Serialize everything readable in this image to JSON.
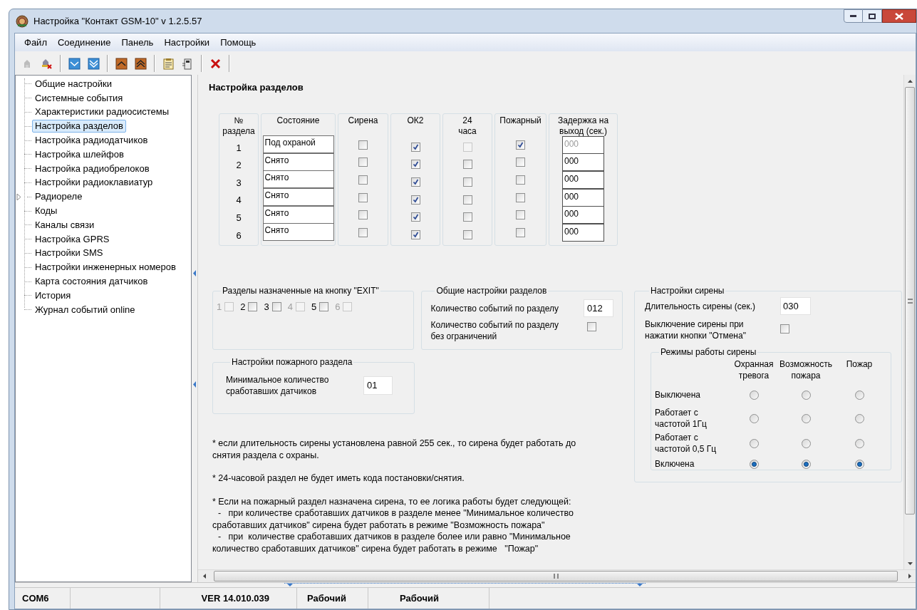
{
  "window": {
    "title": "Настройка \"Контакт GSM-10\" v 1.2.5.57"
  },
  "menu": [
    "Файл",
    "Соединение",
    "Панель",
    "Настройки",
    "Помощь"
  ],
  "toolbar": [
    {
      "kind": "connect",
      "disabled": true
    },
    {
      "kind": "disconnect",
      "disabled": false
    },
    {
      "kind": "separator"
    },
    {
      "kind": "read",
      "disabled": false
    },
    {
      "kind": "read-all",
      "disabled": false
    },
    {
      "kind": "separator"
    },
    {
      "kind": "write",
      "disabled": false
    },
    {
      "kind": "write-all",
      "disabled": false
    },
    {
      "kind": "separator"
    },
    {
      "kind": "notes",
      "disabled": false
    },
    {
      "kind": "device",
      "disabled": false
    },
    {
      "kind": "separator"
    },
    {
      "kind": "delete",
      "disabled": false
    },
    {
      "kind": "separator"
    }
  ],
  "tree": {
    "items": [
      {
        "label": "Общие настройки",
        "kind": "leaf",
        "selected": false
      },
      {
        "label": "Системные события",
        "kind": "leaf",
        "selected": false
      },
      {
        "label": "Характеристики радиосистемы",
        "kind": "leaf",
        "selected": false
      },
      {
        "label": "Настройка разделов",
        "kind": "leaf",
        "selected": true
      },
      {
        "label": "Настройка радиодатчиков",
        "kind": "leaf",
        "selected": false
      },
      {
        "label": "Настройка шлейфов",
        "kind": "leaf",
        "selected": false
      },
      {
        "label": "Настройка радиобрелоков",
        "kind": "leaf",
        "selected": false
      },
      {
        "label": "Настройки радиоклавиатур",
        "kind": "leaf",
        "selected": false
      },
      {
        "label": "Радиореле",
        "kind": "folder",
        "expanded": false,
        "selected": false
      },
      {
        "label": "Коды",
        "kind": "leaf",
        "selected": false
      },
      {
        "label": "Каналы связи",
        "kind": "leaf",
        "selected": false
      },
      {
        "label": "Настройка GPRS",
        "kind": "leaf",
        "selected": false
      },
      {
        "label": "Настройки SMS",
        "kind": "leaf",
        "selected": false
      },
      {
        "label": "Настройки инженерных номеров",
        "kind": "leaf",
        "selected": false
      },
      {
        "label": "Карта состояния датчиков",
        "kind": "leaf",
        "selected": false
      },
      {
        "label": "История",
        "kind": "leaf",
        "selected": false
      },
      {
        "label": "Журнал событий online",
        "kind": "leaf",
        "selected": false
      }
    ]
  },
  "partitions": {
    "title": "Настройка разделов",
    "columns": [
      "№\nраздела",
      "Состояние",
      "Сирена",
      "ОК2",
      "24\nчаса",
      "Пожарный",
      "Задержка на\nвыход (сек.)"
    ],
    "rows": [
      {
        "number": "1",
        "state": "Под охраной",
        "siren": false,
        "ok2": true,
        "h24_checked": false,
        "h24_disabled": true,
        "fire": true,
        "delay": "000",
        "delay_disabled": true
      },
      {
        "number": "2",
        "state": "Снято",
        "siren": false,
        "ok2": true,
        "h24_checked": false,
        "h24_disabled": false,
        "fire": false,
        "delay": "000",
        "delay_disabled": false
      },
      {
        "number": "3",
        "state": "Снято",
        "siren": false,
        "ok2": true,
        "h24_checked": false,
        "h24_disabled": false,
        "fire": false,
        "delay": "000",
        "delay_disabled": false
      },
      {
        "number": "4",
        "state": "Снято",
        "siren": false,
        "ok2": true,
        "h24_checked": false,
        "h24_disabled": false,
        "fire": false,
        "delay": "000",
        "delay_disabled": false
      },
      {
        "number": "5",
        "state": "Снято",
        "siren": false,
        "ok2": true,
        "h24_checked": false,
        "h24_disabled": false,
        "fire": false,
        "delay": "000",
        "delay_disabled": false
      },
      {
        "number": "6",
        "state": "Снято",
        "siren": false,
        "ok2": true,
        "h24_checked": false,
        "h24_disabled": false,
        "fire": false,
        "delay": "000",
        "delay_disabled": false
      }
    ]
  },
  "exit_group": {
    "title": "Разделы назначенные на кнопку \"EXIT\"",
    "items": [
      {
        "label": "1",
        "checked": false,
        "disabled": true
      },
      {
        "label": "2",
        "checked": false,
        "disabled": false
      },
      {
        "label": "3",
        "checked": false,
        "disabled": false
      },
      {
        "label": "4",
        "checked": false,
        "disabled": true
      },
      {
        "label": "5",
        "checked": false,
        "disabled": false
      },
      {
        "label": "6",
        "checked": false,
        "disabled": true
      }
    ]
  },
  "general_group": {
    "title": "Общие настройки разделов",
    "events_label": "Количество событий по разделу",
    "events_value": "012",
    "unlimited_label": "Количество событий по разделу\nбез ограничений",
    "unlimited_checked": false
  },
  "fire_group": {
    "title": "Настройки пожарного раздела",
    "label": "Минимальное количество\nсработавших датчиков",
    "value": "01"
  },
  "siren_group": {
    "title": "Настройки сирены",
    "duration_label": "Длительность сирены (сек.)",
    "duration_value": "030",
    "cancel_label": "Выключение сирены при\nнажатии кнопки \"Отмена\"",
    "cancel_checked": false,
    "modes": {
      "title": "Режимы работы сирены",
      "columns": [
        "Охранная\nтревога",
        "Возможность\nпожара",
        "Пожар"
      ],
      "rows": [
        {
          "label": "Выключена",
          "options": [
            {
              "selected": false
            },
            {
              "selected": false
            },
            {
              "selected": false
            }
          ]
        },
        {
          "label": "Работает с\nчастотой 1Гц",
          "options": [
            {
              "selected": false
            },
            {
              "selected": false
            },
            {
              "selected": false
            }
          ]
        },
        {
          "label": "Работает с\nчастотой 0,5 Гц",
          "options": [
            {
              "selected": false
            },
            {
              "selected": false
            },
            {
              "selected": false
            }
          ]
        },
        {
          "label": "Включена",
          "options": [
            {
              "selected": true
            },
            {
              "selected": true
            },
            {
              "selected": true
            }
          ]
        }
      ]
    }
  },
  "notes": [
    {
      "text": "* если длительность сирены установлена равной 255 сек., то сирена будет работать до снятия раздела с охраны."
    },
    {
      "text": "* 24-часовой раздел не будет иметь кода постановки/снятия."
    },
    {
      "text": "* Если на пожарный раздел назначена сирена, то ее логика работы будет следующей:",
      "bullets": [
        "-   при количестве сработавших датчиков в разделе менее \"Минимальное количество сработавших датчиков\" сирена будет работать в режиме \"Возможность пожара\"",
        "-   при  количестве сработавших датчиков в разделе более или равно \"Минимальное количество сработавших датчиков\" сирена будет работать в режиме   \"Пожар\""
      ]
    }
  ],
  "status_bar": {
    "port": "COM6",
    "version": "VER 14.010.039",
    "state_1": "Рабочий",
    "state_2": "Рабочий"
  }
}
